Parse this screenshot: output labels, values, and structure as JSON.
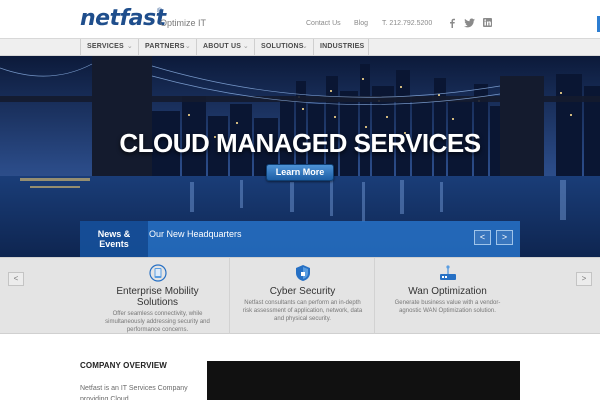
{
  "header": {
    "logo_word": "netfast",
    "logo_reg": "®",
    "logo_tagline": "Optimize IT",
    "contact_label": "Contact Us",
    "blog_label": "Blog",
    "phone_label": "T. 212.792.5200",
    "social_icons": [
      "facebook-icon",
      "twitter-icon",
      "linkedin-icon"
    ]
  },
  "nav": {
    "items": [
      {
        "label": "SERVICES"
      },
      {
        "label": "PARTNERS"
      },
      {
        "label": "ABOUT US"
      },
      {
        "label": "SOLUTIONS"
      },
      {
        "label": "INDUSTRIES"
      }
    ],
    "chevron": "⌄"
  },
  "hero": {
    "title": "CLOUD MANAGED SERVICES",
    "button_label": "Learn More"
  },
  "news": {
    "label_line1": "News &",
    "label_line2": "Events",
    "headline": "Our New Headquarters",
    "prev_label": "<",
    "next_label": ">"
  },
  "services": {
    "prev_label": "<",
    "next_label": ">",
    "items": [
      {
        "icon": "mobile-device-icon",
        "title_line1": "Enterprise Mobility",
        "title_line2": "Solutions",
        "desc": "Offer seamless connectivity, while simultaneously addressing security and performance concerns."
      },
      {
        "icon": "shield-icon",
        "title": "Cyber Security",
        "desc": "Netfast consultants can perform an in-depth risk assessment of application, network, data and physical security."
      },
      {
        "icon": "router-icon",
        "title": "Wan Optimization",
        "desc": "Generate business value with a vendor-agnostic WAN Optimization solution."
      }
    ]
  },
  "overview": {
    "heading": "COMPANY OVERVIEW",
    "text": "Netfast is an IT Services Company providing Cloud"
  },
  "colors": {
    "brand_blue": "#1f4e8c",
    "accent_blue": "#2670c4",
    "nav_bg": "#efefef",
    "services_bg": "#e4e4e4"
  }
}
